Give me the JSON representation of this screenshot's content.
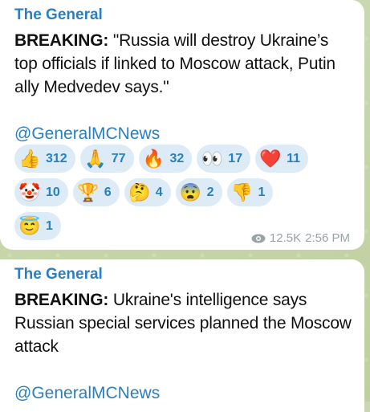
{
  "messages": [
    {
      "channel": "The General",
      "breaking_label": "BREAKING:",
      "body": " \"Russia will destroy Ukraine’s top officials if linked to Moscow attack, Putin ally Medvedev says.\"",
      "link": "@GeneralMCNews",
      "reactions_row1": [
        {
          "emoji": "👍",
          "count": "312",
          "icon": "thumbs-up-icon"
        },
        {
          "emoji": "🙏",
          "count": "77",
          "icon": "praying-hands-icon"
        },
        {
          "emoji": "🔥",
          "count": "32",
          "icon": "fire-icon"
        },
        {
          "emoji": "👀",
          "count": "17",
          "icon": "eyes-icon"
        },
        {
          "emoji": "❤️",
          "count": "11",
          "icon": "heart-icon"
        }
      ],
      "reactions_row2": [
        {
          "emoji": "🤡",
          "count": "10",
          "icon": "clown-icon"
        },
        {
          "emoji": "🏆",
          "count": "6",
          "icon": "trophy-icon"
        },
        {
          "emoji": "🤔",
          "count": "4",
          "icon": "thinking-face-icon"
        },
        {
          "emoji": "😨",
          "count": "2",
          "icon": "fearful-face-icon"
        },
        {
          "emoji": "👎",
          "count": "1",
          "icon": "thumbs-down-icon"
        }
      ],
      "reactions_row3": [
        {
          "emoji": "😇",
          "count": "1",
          "icon": "halo-face-icon"
        }
      ],
      "views": "12.5K",
      "time": "2:56 PM"
    },
    {
      "channel": "The General",
      "breaking_label": "BREAKING:",
      "body": " Ukraine's intelligence says Russian special services planned the Moscow attack",
      "link": "@GeneralMCNews"
    }
  ]
}
